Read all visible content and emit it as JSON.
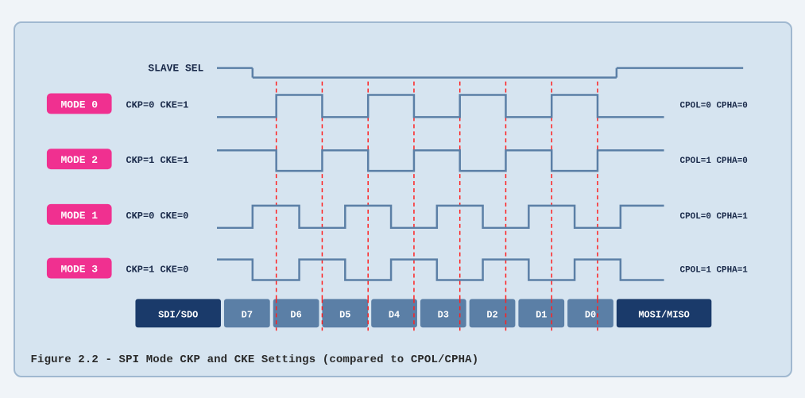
{
  "caption": "Figure 2.2 - SPI Mode CKP and CKE Settings (compared to CPOL/CPHA)",
  "diagram": {
    "slave_sel_label": "SLAVE SEL",
    "modes": [
      {
        "label": "MODE 0",
        "ckp_cke": "CKP=0  CKE=1",
        "cpol_cpha": "CPOL=0  CPHA=0"
      },
      {
        "label": "MODE 2",
        "ckp_cke": "CKP=1  CKE=1",
        "cpol_cpha": "CPOL=1  CPHA=0"
      },
      {
        "label": "MODE 1",
        "ckp_cke": "CKP=0  CKE=0",
        "cpol_cpha": "CPOL=0  CPHA=1"
      },
      {
        "label": "MODE 3",
        "ckp_cke": "CKP=1  CKE=0",
        "cpol_cpha": "CPOL=1  CPHA=1"
      }
    ],
    "data_bits": [
      "SDI/SDO",
      "D7",
      "D6",
      "D5",
      "D4",
      "D3",
      "D2",
      "D1",
      "D0",
      "MOSI/MISO"
    ]
  }
}
